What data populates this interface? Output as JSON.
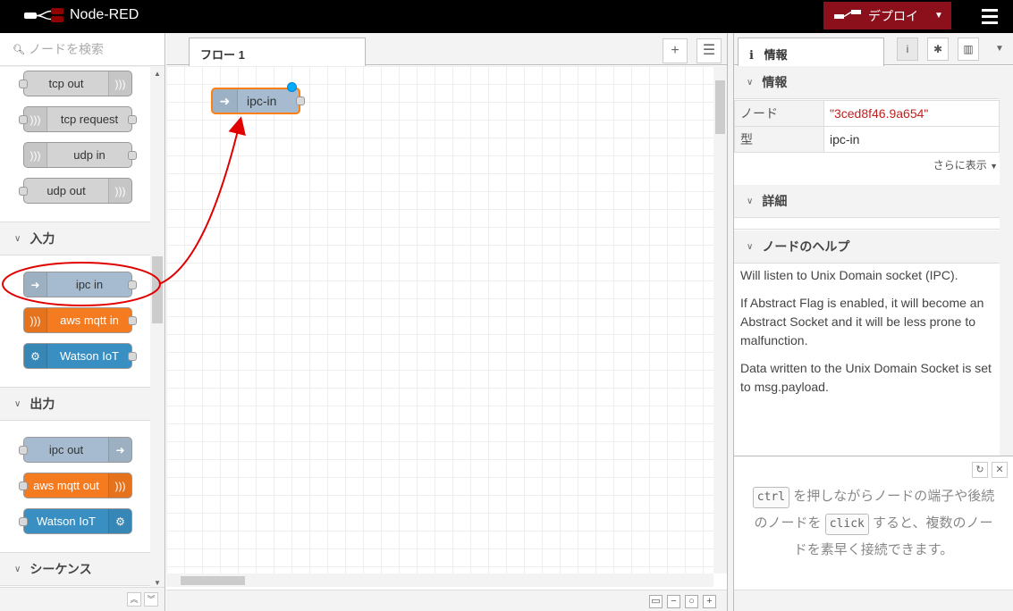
{
  "app": {
    "title": "Node-RED",
    "deploy_label": "デプロイ",
    "accent": "#8c101c"
  },
  "palette": {
    "search_placeholder": "ノードを検索",
    "nodes_top": [
      {
        "label": "tcp out"
      },
      {
        "label": "tcp request"
      },
      {
        "label": "udp in"
      },
      {
        "label": "udp out"
      }
    ],
    "input_category": "入力",
    "input_nodes": [
      {
        "label": "ipc in"
      },
      {
        "label": "aws mqtt in"
      },
      {
        "label": "Watson IoT"
      }
    ],
    "output_category": "出力",
    "output_nodes": [
      {
        "label": "ipc out"
      },
      {
        "label": "aws mqtt out"
      },
      {
        "label": "Watson IoT"
      }
    ],
    "sequence_category": "シーケンス"
  },
  "workspace": {
    "tab_label": "フロー 1",
    "flow_node_label": "ipc-in"
  },
  "sidebar": {
    "tab_label": "情報",
    "info_header": "情報",
    "props": [
      {
        "key": "ノード",
        "value": "\"3ced8f46.9a654\""
      },
      {
        "key": "型",
        "value": "ipc-in"
      }
    ],
    "more_label": "さらに表示",
    "details_header": "詳細",
    "help_header": "ノードのヘルプ",
    "help_paragraphs": [
      "Will listen to Unix Domain socket (IPC).",
      "If Abstract Flag is enabled, it will become an Abstract Socket and it will be less prone to malfunction.",
      "Data written to the Unix Domain Socket is set to msg.payload."
    ],
    "tip": {
      "key1": "ctrl",
      "text1": "を押しながらノードの端子や後続のノードを",
      "key2": "click",
      "text2": "すると、複数のノードを素早く接続できます。"
    }
  }
}
